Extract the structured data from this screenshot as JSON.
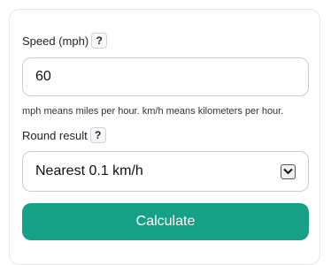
{
  "speed": {
    "label": "Speed (mph)",
    "help": "?",
    "value": "60",
    "hint": "mph means miles per hour. km/h means kilometers per hour."
  },
  "round": {
    "label": "Round result",
    "help": "?",
    "selected": "Nearest 0.1 km/h",
    "arrow_icon": "chevron-down-icon"
  },
  "actions": {
    "calculate_label": "Calculate",
    "button_color": "#16a085"
  }
}
